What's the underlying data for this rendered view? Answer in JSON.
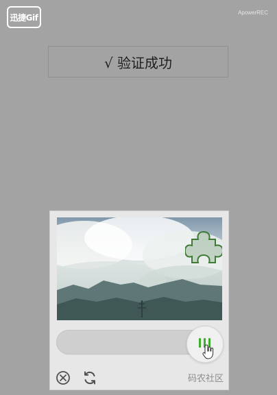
{
  "watermarks": {
    "app_badge": "迅捷Gif",
    "recorder": "ApowerREC"
  },
  "result": {
    "text": "√ 验证成功"
  },
  "captcha": {
    "footer_brand": "码农社区"
  }
}
